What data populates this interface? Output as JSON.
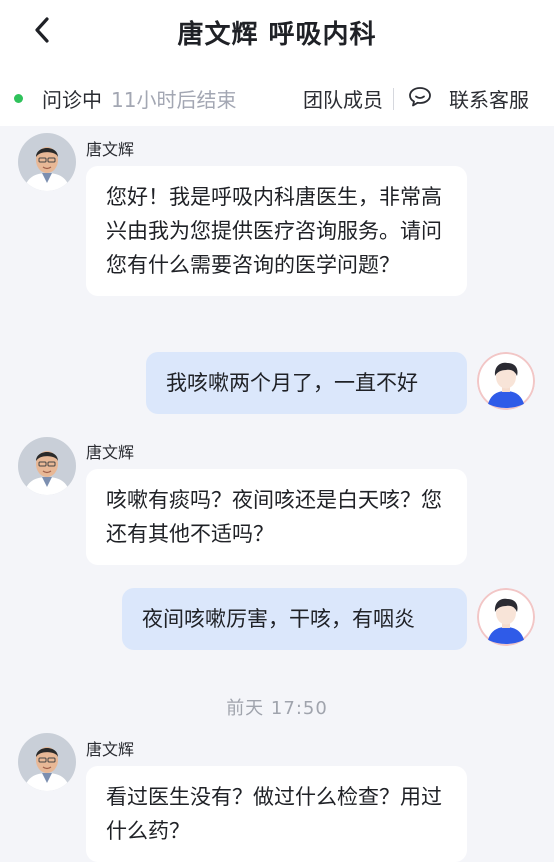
{
  "header": {
    "title": "唐文辉 呼吸内科",
    "back_icon": "chevron-left-icon"
  },
  "status": {
    "state": "问诊中",
    "remaining": "11小时后结束",
    "team_label": "团队成员",
    "service_label": "联系客服",
    "service_icon": "chat-bubble-icon",
    "dot_color": "#2fc25b"
  },
  "messages": [
    {
      "from": "doctor",
      "name": "唐文辉",
      "text": "您好！我是呼吸内科唐医生，非常高兴由我为您提供医疗咨询服务。请问您有什么需要咨询的医学问题？"
    },
    {
      "from": "patient",
      "text": "我咳嗽两个月了，一直不好"
    },
    {
      "from": "doctor",
      "name": "唐文辉",
      "text": "咳嗽有痰吗？夜间咳还是白天咳？您还有其他不适吗？"
    },
    {
      "from": "patient",
      "text": "夜间咳嗽厉害，干咳，有咽炎"
    },
    {
      "from": "doctor",
      "name": "唐文辉",
      "text": "看过医生没有？做过什么检查？用过什么药？"
    }
  ],
  "timestamp": "前天  17:50",
  "colors": {
    "patient_bubble": "#dbe7fb",
    "doctor_bubble": "#ffffff",
    "background": "#f4f5f9"
  }
}
